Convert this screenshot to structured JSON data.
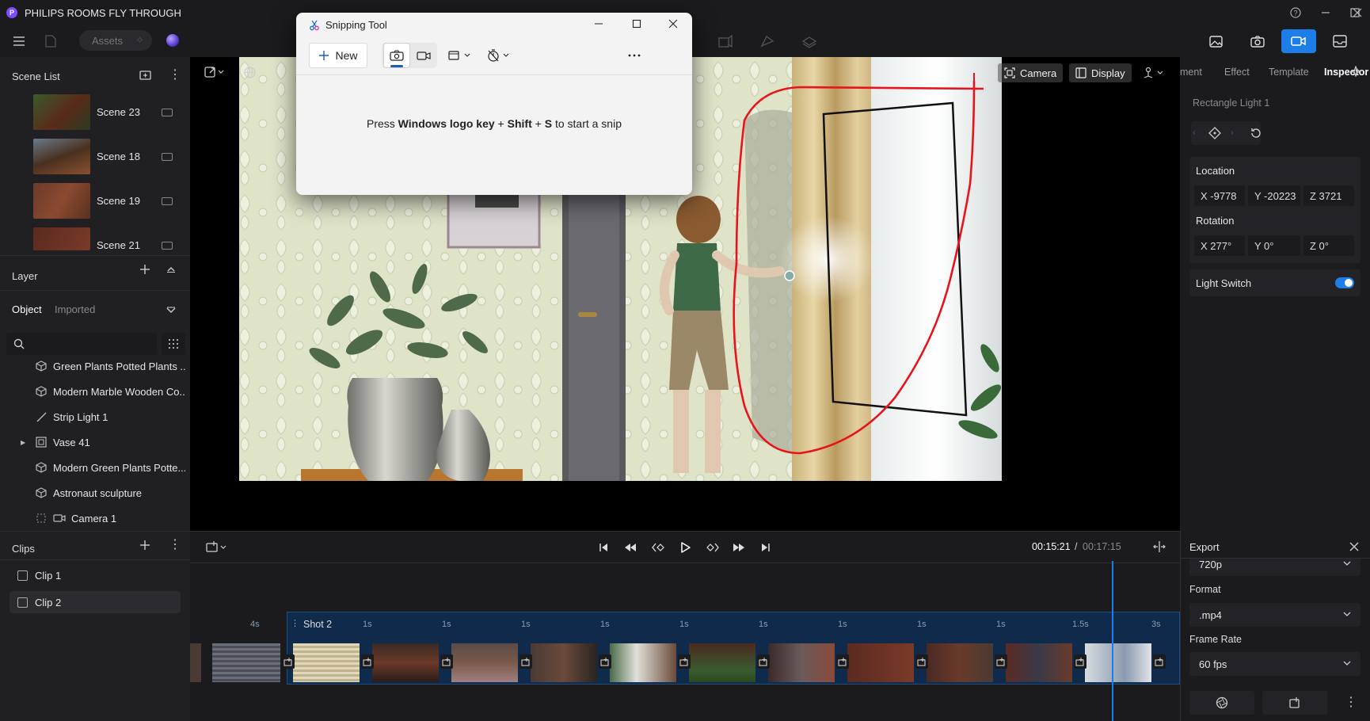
{
  "app": {
    "title": "PHILIPS ROOMS FLY THROUGH",
    "logo_letter": "P"
  },
  "toolbar": {
    "assets_label": "Assets"
  },
  "scene_list": {
    "title": "Scene List",
    "items": [
      {
        "label": "Scene 23"
      },
      {
        "label": "Scene 18"
      },
      {
        "label": "Scene 19"
      },
      {
        "label": "Scene 21"
      }
    ]
  },
  "layer": {
    "title": "Layer",
    "tab_object": "Object",
    "tab_imported": "Imported",
    "items": [
      {
        "label": "Green Plants Potted Plants ...",
        "icon": "cube-icon"
      },
      {
        "label": "Modern Marble Wooden Co...",
        "icon": "cube-icon"
      },
      {
        "label": "Strip Light 1",
        "icon": "strip-light-icon"
      },
      {
        "label": "Vase 41",
        "icon": "group-icon"
      },
      {
        "label": "Modern Green Plants Potte...",
        "icon": "cube-icon"
      },
      {
        "label": "Astronaut sculpture",
        "icon": "cube-icon"
      },
      {
        "label": "Camera 1",
        "icon": "camera-icon"
      }
    ]
  },
  "clips": {
    "title": "Clips",
    "items": [
      {
        "label": "Clip 1"
      },
      {
        "label": "Clip 2"
      }
    ]
  },
  "viewport": {
    "camera_label": "Camera",
    "display_label": "Display"
  },
  "inspector": {
    "tabs": [
      "ment",
      "Effect",
      "Template",
      "Inspector"
    ],
    "object_name": "Rectangle Light 1",
    "location_label": "Location",
    "location": {
      "x": "X  -9778",
      "y": "Y  -20223",
      "z": "Z  3721"
    },
    "rotation_label": "Rotation",
    "rotation": {
      "x": "X  277°",
      "y": "Y  0°",
      "z": "Z  0°"
    },
    "light_switch_label": "Light Switch",
    "light_switch_on": true
  },
  "timeline": {
    "current_time": "00:15:21",
    "separator": "/",
    "total_time": "00:17:15",
    "shot_label": "Shot 2",
    "ticks": [
      "4s",
      "1s",
      "1s",
      "1s",
      "1s",
      "1s",
      "1s",
      "1s",
      "1s",
      "1s",
      "1.5s",
      "3s"
    ]
  },
  "export": {
    "title": "Export",
    "resolution": "720p",
    "format_label": "Format",
    "format": ".mp4",
    "frame_rate_label": "Frame Rate",
    "frame_rate": "60 fps"
  },
  "snipping_tool": {
    "title": "Snipping Tool",
    "new_label": "New",
    "message_pre": "Press ",
    "message_bold1": "Windows logo key",
    "message_mid1": " + ",
    "message_bold2": "Shift",
    "message_mid2": " + ",
    "message_bold3": "S",
    "message_post": " to start a snip"
  },
  "colors": {
    "accent": "#1e7ee8",
    "annotation_red": "#e8141c",
    "timeline_track": "#0f2a4a"
  }
}
